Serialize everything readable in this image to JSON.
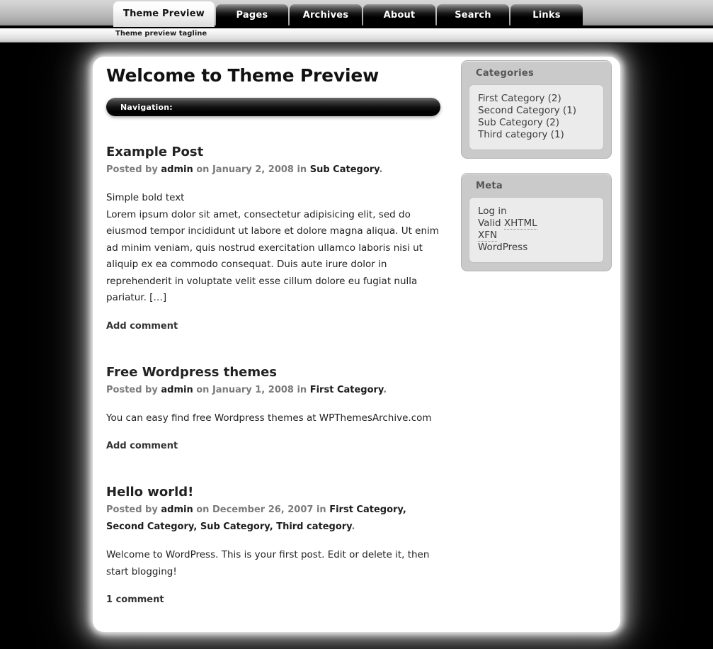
{
  "header": {
    "tagline": "Theme preview tagline",
    "tabs": [
      {
        "label": "Theme Preview",
        "active": true
      },
      {
        "label": "Pages",
        "active": false
      },
      {
        "label": "Archives",
        "active": false
      },
      {
        "label": "About",
        "active": false
      },
      {
        "label": "Search",
        "active": false
      },
      {
        "label": "Links",
        "active": false
      }
    ]
  },
  "main": {
    "page_title": "Welcome to Theme Preview",
    "navigation_label": "Navigation:",
    "posts": [
      {
        "title": "Example Post",
        "meta_prefix": "Posted by ",
        "author": "admin",
        "meta_mid": " on January 2, 2008 in ",
        "categories": "Sub Category",
        "meta_suffix": ".",
        "body_line1": "Simple bold text",
        "body_line2": "Lorem ipsum dolor sit amet, consectetur adipisicing elit, sed do eiusmod tempor incididunt ut labore et dolore magna aliqua. Ut enim ad minim veniam, quis nostrud exercitation ullamco laboris nisi ut aliquip ex ea commodo consequat. Duis aute irure dolor in reprehenderit in voluptate velit esse cillum dolore eu fugiat nulla pariatur. […]",
        "comment_link": "Add comment"
      },
      {
        "title": "Free Wordpress themes",
        "meta_prefix": "Posted by ",
        "author": "admin",
        "meta_mid": " on January 1, 2008 in ",
        "categories": "First Category",
        "meta_suffix": ".",
        "body_line1": "You can easy find free Wordpress themes at WPThemesArchive.com",
        "body_line2": "",
        "comment_link": "Add comment"
      },
      {
        "title": "Hello world!",
        "meta_prefix": "Posted by ",
        "author": "admin",
        "meta_mid": " on December 26, 2007 in ",
        "categories": "First Category, Second Category, Sub Category, Third category",
        "meta_suffix": ".",
        "body_line1": "Welcome to WordPress. This is your first post. Edit or delete it, then start blogging!",
        "body_line2": "",
        "comment_link": "1 comment"
      }
    ]
  },
  "sidebar": {
    "widgets": [
      {
        "title": "Categories",
        "items": [
          {
            "text": "First Category (2)",
            "dotted": false
          },
          {
            "text": "Second Category (1)",
            "dotted": false
          },
          {
            "text": "Sub Category (2)",
            "dotted": false
          },
          {
            "text": "Third category (1)",
            "dotted": false
          }
        ]
      },
      {
        "title": "Meta",
        "items": [
          {
            "text": "Log in",
            "dotted": false
          },
          {
            "text": "Valid XHTML",
            "dotted": true,
            "plain": "Valid ",
            "marked": "XHTML"
          },
          {
            "text": "XFN",
            "dotted": true,
            "plain": "",
            "marked": "XFN"
          },
          {
            "text": "WordPress",
            "dotted": false
          }
        ]
      }
    ]
  },
  "colors": {
    "page_background": "#000000",
    "card_background": "#ffffff",
    "widget_background": "#cacaca",
    "widget_inner_background": "#ebebeb",
    "tab_active_text": "#111111",
    "tab_inactive_text": "#ffffff"
  }
}
